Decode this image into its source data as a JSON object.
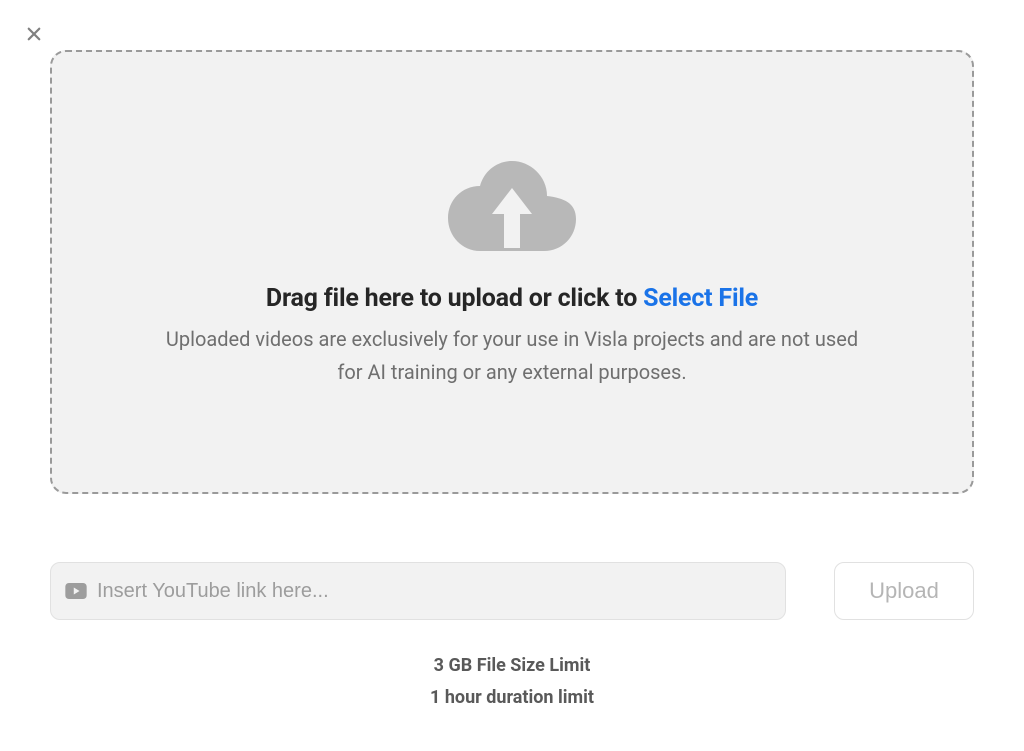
{
  "dropzone": {
    "title_prefix": "Drag file here to upload or click to ",
    "select_file_label": "Select File",
    "subtitle": "Uploaded videos are exclusively for your use in Visla projects and are not used for AI training or any external purposes."
  },
  "youtube": {
    "placeholder": "Insert YouTube link here..."
  },
  "upload_button": {
    "label": "Upload"
  },
  "limits": {
    "file_size": "3 GB File Size Limit",
    "duration": "1 hour duration limit"
  }
}
